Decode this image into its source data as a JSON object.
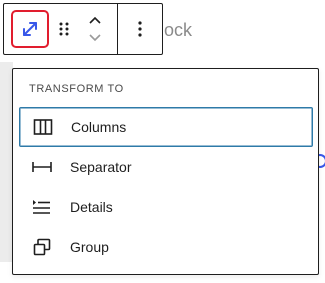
{
  "background": {
    "placeholder_text": "block"
  },
  "toolbar": {
    "transform_icon": "arrows-expand-icon",
    "drag_icon": "drag-handle-icon",
    "move_up_icon": "chevron-up-icon",
    "move_down_icon": "chevron-down-icon",
    "more_icon": "more-vertical-icon"
  },
  "dropdown": {
    "heading": "TRANSFORM TO",
    "items": [
      {
        "label": "Columns",
        "icon": "columns-icon",
        "active": true
      },
      {
        "label": "Separator",
        "icon": "separator-icon",
        "active": false
      },
      {
        "label": "Details",
        "icon": "details-icon",
        "active": false
      },
      {
        "label": "Group",
        "icon": "group-icon",
        "active": false
      }
    ]
  },
  "colors": {
    "accent": "#3858e9",
    "highlight": "#e11d2e",
    "focus": "#2e7aa8",
    "text": "#1e1e1e"
  }
}
